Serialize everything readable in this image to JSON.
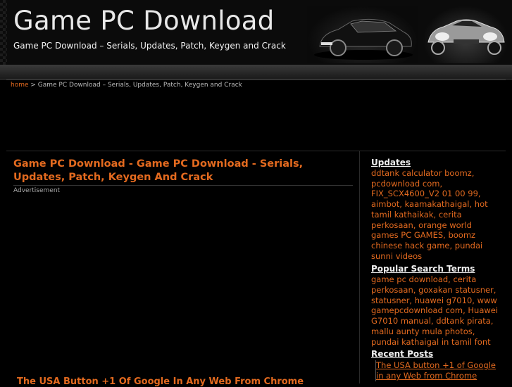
{
  "header": {
    "title": "Game PC Download",
    "tagline": "Game PC Download – Serials, Updates, Patch, Keygen and Crack"
  },
  "breadcrumb": {
    "home": "home",
    "separator": " > ",
    "current": "Game PC Download – Serials, Updates, Patch, Keygen and Crack"
  },
  "post": {
    "title": "Game PC Download - Game PC Download - Serials, Updates, Patch, Keygen And Crack",
    "advert_label": "Advertisement",
    "next_title": "The USA Button +1 Of Google In Any Web From Chrome"
  },
  "sidebar": {
    "updates_heading": "Updates",
    "updates_text": "ddtank calculator boomz, pcdownload com, FIX_SCX4600_V2 01 00 99, aimbot, kaamakathaigal, hot tamil kathaikak, cerita perkosaan, orange world games PC GAMES, boomz chinese hack game, pundai sunni videos",
    "popular_heading": "Popular Search Terms",
    "popular_text": "game pc download, cerita perkosaan, goxakan statusner, statusner, huawei g7010, www gamepcdownload com, Huawei G7010 manual, ddtank pirata, mallu aunty mula photos, pundai kathaigal in tamil font",
    "recent_heading": "Recent Posts",
    "recent_item": "The USA button +1 of Google in any Web from Chrome"
  },
  "colors": {
    "accent": "#e36a1f",
    "background": "#000000"
  }
}
